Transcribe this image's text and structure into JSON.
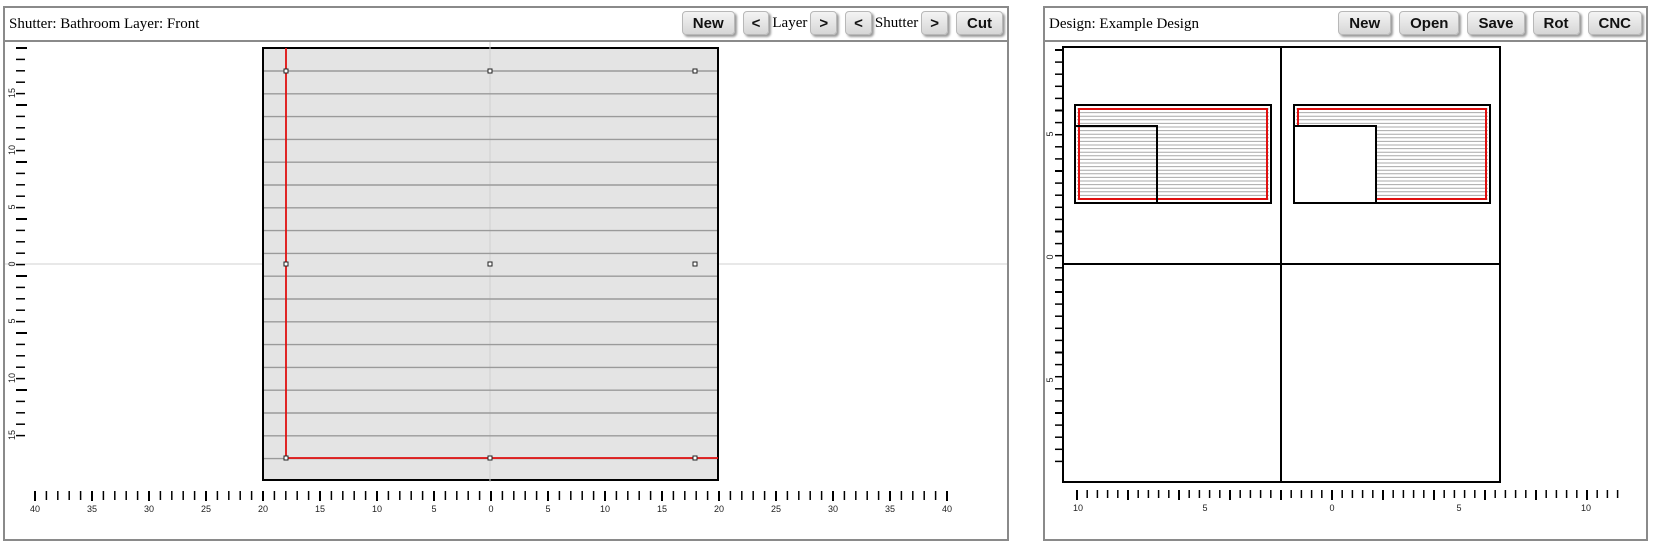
{
  "shutter_panel": {
    "title": "Shutter: Bathroom Layer: Front",
    "buttons": {
      "new": "New",
      "layer_prev": "<",
      "layer_label": "Layer",
      "layer_next": ">",
      "shutter_prev": "<",
      "shutter_label": "Shutter",
      "shutter_next": ">",
      "cut": "Cut"
    },
    "x_ticks": [
      "40",
      "35",
      "30",
      "25",
      "20",
      "15",
      "10",
      "5",
      "0",
      "5",
      "10",
      "15",
      "20",
      "25",
      "30",
      "35",
      "40"
    ],
    "y_ticks": [
      "15",
      "10",
      "5",
      "0",
      "5",
      "10",
      "15"
    ]
  },
  "design_panel": {
    "title": "Design: Example Design",
    "buttons": {
      "new": "New",
      "open": "Open",
      "save": "Save",
      "rot": "Rot",
      "cnc": "CNC"
    },
    "x_ticks": [
      "10",
      "5",
      "0",
      "5",
      "10"
    ],
    "y_ticks": [
      "5",
      "0",
      "5"
    ]
  },
  "colors": {
    "frame_red": "#e01010",
    "panel_fill": "#e4e4e4",
    "louver_gray": "#9a9a9a",
    "border_gray": "#8a8a8a"
  }
}
